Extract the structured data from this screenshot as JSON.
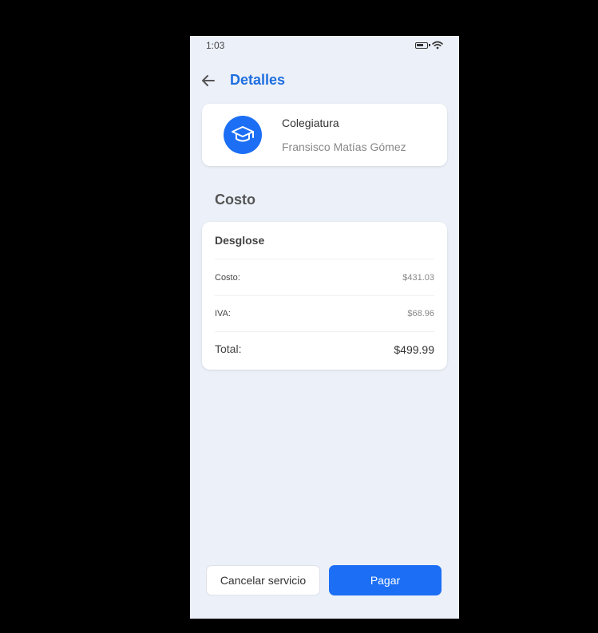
{
  "status_bar": {
    "time": "1:03",
    "icons": [
      "battery-icon",
      "wifi-icon"
    ]
  },
  "header": {
    "title": "Detalles",
    "back_icon": "arrow-left-icon"
  },
  "service": {
    "icon": "graduation-cap-icon",
    "name": "Colegiatura",
    "person": "Fransisco Matías Gómez"
  },
  "section": {
    "title": "Costo"
  },
  "breakdown": {
    "title": "Desglose",
    "rows": [
      {
        "label": "Costo:",
        "value": "$431.03"
      },
      {
        "label": "IVA:",
        "value": "$68.96"
      },
      {
        "label": "Total:",
        "value": "$499.99"
      }
    ]
  },
  "actions": {
    "cancel_label": "Cancelar servicio",
    "pay_label": "Pagar"
  },
  "colors": {
    "accent": "#1C6FF5",
    "title": "#1E6FE0",
    "background": "#ECF0F8"
  }
}
